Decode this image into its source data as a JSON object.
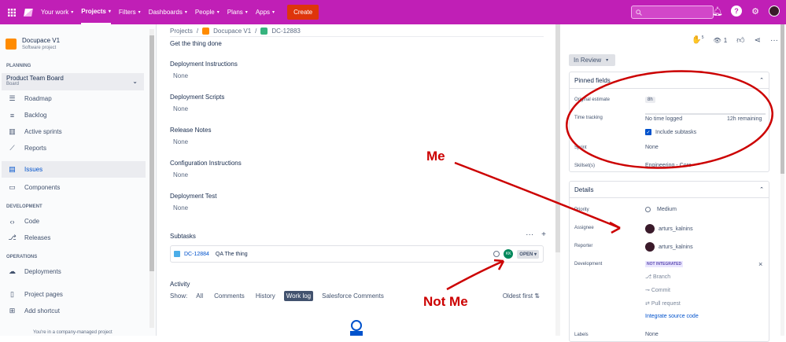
{
  "topbar": {
    "nav": [
      {
        "label": "Your work"
      },
      {
        "label": "Projects"
      },
      {
        "label": "Filters"
      },
      {
        "label": "Dashboards"
      },
      {
        "label": "People"
      },
      {
        "label": "Plans"
      },
      {
        "label": "Apps"
      }
    ],
    "create_label": "Create",
    "search_placeholder": "Search",
    "brand_color": "#c01fb6",
    "create_color": "#de350b"
  },
  "sidebar": {
    "project_name": "Docupace V1",
    "project_type": "Software project",
    "planning_label": "PLANNING",
    "board_name": "Product Team Board",
    "board_type": "Board",
    "planning_items": [
      {
        "label": "Roadmap",
        "icon": "roadmap-icon"
      },
      {
        "label": "Backlog",
        "icon": "backlog-icon"
      },
      {
        "label": "Active sprints",
        "icon": "sprints-icon"
      },
      {
        "label": "Reports",
        "icon": "reports-icon"
      }
    ],
    "issues_label": "Issues",
    "components_label": "Components",
    "development_label": "DEVELOPMENT",
    "code_label": "Code",
    "releases_label": "Releases",
    "operations_label": "OPERATIONS",
    "deployments_label": "Deployments",
    "project_pages_label": "Project pages",
    "add_shortcut_label": "Add shortcut",
    "footer_text": "You're in a company-managed project"
  },
  "main": {
    "breadcrumb": [
      "Projects",
      "Docupace V1",
      "DC-12883"
    ],
    "description": "Get the thing done",
    "fields": [
      {
        "label": "Deployment Instructions",
        "value": "None"
      },
      {
        "label": "Deployment Scripts",
        "value": "None"
      },
      {
        "label": "Release Notes",
        "value": "None"
      },
      {
        "label": "Configuration Instructions",
        "value": "None"
      },
      {
        "label": "Deployment Test",
        "value": "None"
      }
    ],
    "subtasks_label": "Subtasks",
    "subtask": {
      "key": "DC-12884",
      "summary": "QA The thing",
      "assignee_initials": "KK",
      "status": "OPEN"
    },
    "activity_label": "Activity",
    "show_label": "Show:",
    "activity_tabs": [
      "All",
      "Comments",
      "History",
      "Work log",
      "Salesforce Comments"
    ],
    "selected_tab": "Work log",
    "sort_label": "Oldest first"
  },
  "right": {
    "watch_count": "1",
    "vote_count": "5",
    "status": "In Review",
    "pinned_title": "Pinned fields",
    "original_estimate_label": "Original estimate",
    "original_estimate": "8h",
    "time_tracking_label": "Time tracking",
    "no_time_logged": "No time logged",
    "remaining": "12h remaining",
    "include_subtasks": "Include subtasks",
    "sprint_label": "Sprint",
    "sprint_value": "None",
    "skillset_label": "Skillset(s)",
    "skillset_value": "Engineering - Core",
    "details_title": "Details",
    "priority_label": "Priority",
    "priority_value": "Medium",
    "assignee_label": "Assignee",
    "assignee_value": "arturs_kalnins",
    "reporter_label": "Reporter",
    "reporter_value": "arturs_kalnins",
    "development_label": "Development",
    "dev_badge": "NOT INTEGRATED",
    "branch": "Branch",
    "commit": "Commit",
    "pull_request": "Pull request",
    "integrate": "Integrate source code",
    "labels_label": "Labels",
    "labels_value": "None"
  },
  "annotations": {
    "me_label": "Me",
    "not_me_label": "Not Me",
    "color": "#cc0000"
  }
}
